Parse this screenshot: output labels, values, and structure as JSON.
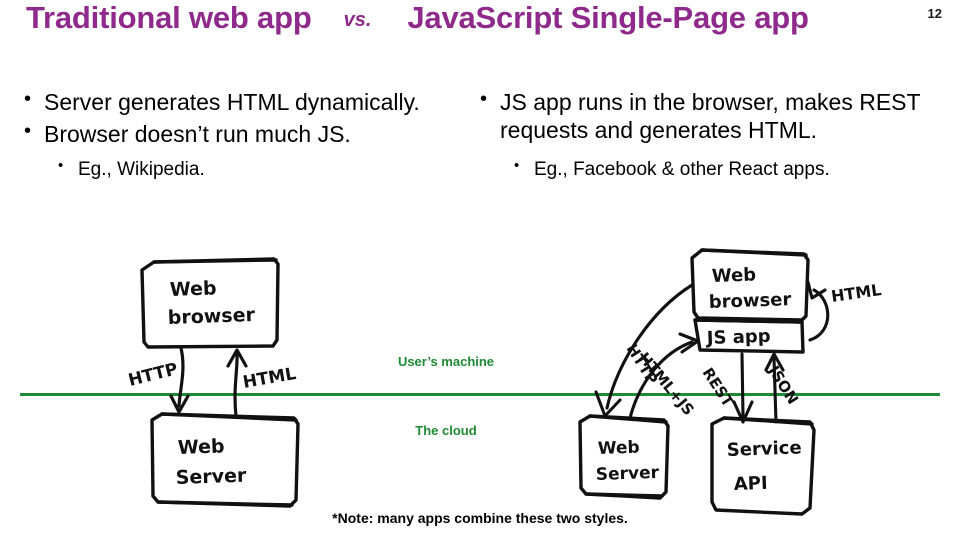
{
  "slide": {
    "number": "12",
    "title": {
      "left": "Traditional web app",
      "vs": "vs.",
      "right": "JavaScript Single-Page app"
    },
    "footnote": "*Note: many apps combine these two styles.",
    "divider_color": "#1e8a34",
    "title_color": "#8f2a8c",
    "zone_label_color": "#1e8a34"
  },
  "columns": {
    "left": {
      "bullets": [
        "Server generates HTML dynamically.",
        "Browser doesn’t run much JS."
      ],
      "sub_bullet": "Eg., Wikipedia."
    },
    "right": {
      "bullets": [
        "JS app runs in the browser, makes REST requests and generates HTML."
      ],
      "sub_bullet": "Eg., Facebook & other React apps."
    }
  },
  "zones": {
    "users_machine": "User’s machine",
    "the_cloud": "The cloud"
  },
  "diagram_left": {
    "boxes": [
      {
        "id": "web-browser",
        "label_line1": "Web",
        "label_line2": "browser"
      },
      {
        "id": "web-server",
        "label_line1": "Web",
        "label_line2": "Server"
      }
    ],
    "arrows": [
      {
        "id": "http",
        "label": "HTTP",
        "from": "web-browser",
        "to": "web-server"
      },
      {
        "id": "html",
        "label": "HTML",
        "from": "web-server",
        "to": "web-browser"
      }
    ]
  },
  "diagram_right": {
    "boxes": [
      {
        "id": "web-browser",
        "label_line1": "Web",
        "label_line2": "browser"
      },
      {
        "id": "js-app",
        "label_line1": "JS  app",
        "label_line2": ""
      },
      {
        "id": "web-server",
        "label_line1": "Web",
        "label_line2": "Server"
      },
      {
        "id": "service-api",
        "label_line1": "Service",
        "label_line2": "API"
      }
    ],
    "arrows": [
      {
        "id": "http",
        "label": "HTTP",
        "from": "web-browser",
        "to": "web-server"
      },
      {
        "id": "html-js",
        "label": "HTML+JS",
        "from": "web-server",
        "to": "js-app"
      },
      {
        "id": "rest",
        "label": "REST",
        "from": "js-app",
        "to": "service-api"
      },
      {
        "id": "json",
        "label": "JSON",
        "from": "service-api",
        "to": "js-app"
      },
      {
        "id": "html",
        "label": "HTML",
        "from": "js-app",
        "to": "web-browser"
      }
    ]
  }
}
